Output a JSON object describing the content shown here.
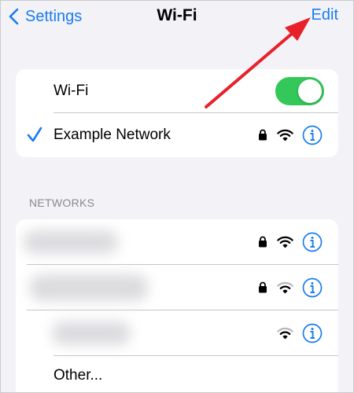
{
  "nav": {
    "back_label": "Settings",
    "title": "Wi-Fi",
    "edit_label": "Edit"
  },
  "wifi_card": {
    "toggle_label": "Wi-Fi",
    "toggle_on": true,
    "connected_network": "Example Network"
  },
  "networks": {
    "header": "NETWORKS",
    "items": [
      {
        "name": "",
        "secured": true,
        "signal": 3
      },
      {
        "name": "",
        "secured": true,
        "signal": 2
      },
      {
        "name": "",
        "secured": false,
        "signal": 2
      }
    ],
    "other_label": "Other..."
  },
  "colors": {
    "accent": "#1a7cf0",
    "toggle_on": "#34c759",
    "background": "#f2f2f7",
    "annotation_arrow": "#e8202a"
  },
  "icons": [
    "chevron-left-icon",
    "checkmark-icon",
    "lock-icon",
    "wifi-icon",
    "info-icon"
  ]
}
